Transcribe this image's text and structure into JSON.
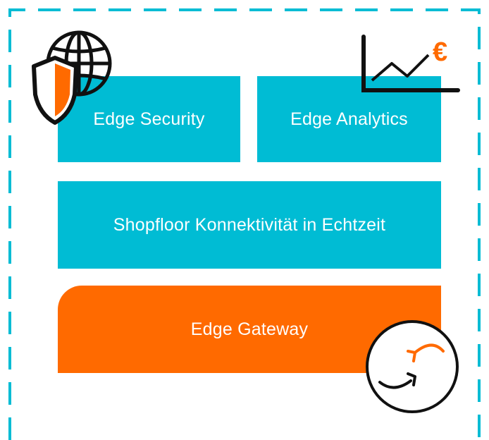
{
  "blocks": {
    "edge_security": "Edge Security",
    "edge_analytics": "Edge Analytics",
    "shopfloor": "Shopfloor Konnektivität in Echtzeit",
    "edge_gateway": "Edge Gateway"
  },
  "icons": {
    "security": "globe-shield-icon",
    "analytics": "line-chart-euro-icon",
    "gateway": "refresh-cycle-icon",
    "euro_symbol": "€"
  },
  "colors": {
    "cyan": "#00bcd4",
    "orange": "#ff6a00",
    "border": "#00bcd4",
    "stroke": "#111111"
  }
}
